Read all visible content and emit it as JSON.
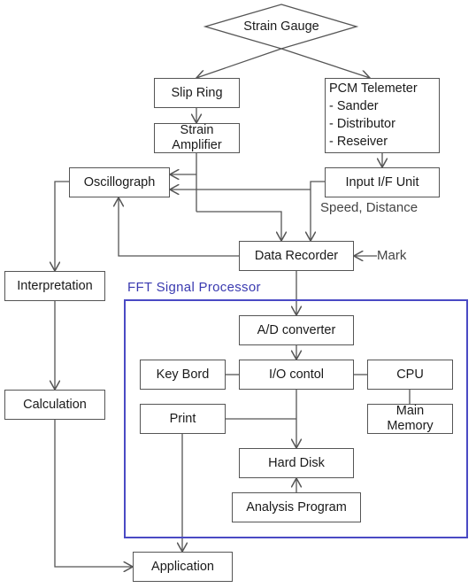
{
  "diagram": {
    "nodes": {
      "strain_gauge": "Strain Gauge",
      "slip_ring": "Slip Ring",
      "strain_amplifier": [
        "Strain",
        "Amplifier"
      ],
      "pcm_telemeter": {
        "title": "PCM Telemeter",
        "items": [
          "- Sander",
          "- Distributor",
          "- Reseiver"
        ]
      },
      "oscillograph": "Oscillograph",
      "input_if_unit": "Input I/F Unit",
      "data_recorder": "Data Recorder",
      "interpretation": "Interpretation",
      "calculation": "Calculation",
      "application": "Application",
      "ad_converter": "A/D converter",
      "key_bord": "Key Bord",
      "io_control": "I/O contol",
      "cpu": "CPU",
      "print": "Print",
      "main_memory": [
        "Main",
        "Memory"
      ],
      "hard_disk": "Hard Disk",
      "analysis_program": "Analysis Program"
    },
    "annotations": {
      "speed_distance": "Speed, Distance",
      "mark": "Mark"
    },
    "group": {
      "label": "FFT Signal Processor",
      "color": "#4040c0"
    },
    "line_color": "#555555"
  }
}
